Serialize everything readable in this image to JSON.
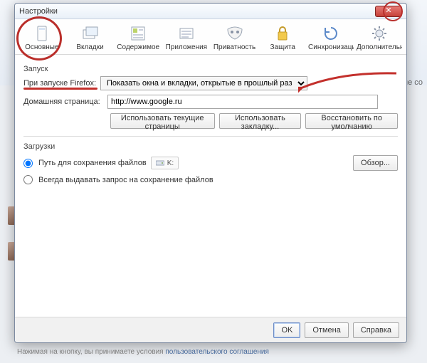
{
  "bg": {
    "right_text_fragment": "ругие со",
    "footer_prefix": "Нажимая на кнопку, вы принимаете условия ",
    "footer_link": "пользовательского соглашения"
  },
  "dialog": {
    "title": "Настройки",
    "close_glyph": "✕",
    "toolbar": [
      {
        "key": "general",
        "label": "Основные"
      },
      {
        "key": "tabs",
        "label": "Вкладки"
      },
      {
        "key": "content",
        "label": "Содержимое"
      },
      {
        "key": "apps",
        "label": "Приложения"
      },
      {
        "key": "privacy",
        "label": "Приватность"
      },
      {
        "key": "security",
        "label": "Защита"
      },
      {
        "key": "sync",
        "label": "Синхронизация"
      },
      {
        "key": "advanced",
        "label": "Дополнительные"
      }
    ],
    "startup": {
      "group_label": "Запуск",
      "prefix_label": "При запуске Firefox:",
      "selected_option": "Показать окна и вкладки, открытые в прошлый раз"
    },
    "homepage": {
      "label": "Домашняя страница:",
      "value": "http://www.google.ru",
      "btn_current": "Использовать текущие страницы",
      "btn_bookmark": "Использовать закладку...",
      "btn_restore": "Восстановить по умолчанию"
    },
    "downloads": {
      "group_label": "Загрузки",
      "radio_save_label": "Путь для сохранения файлов",
      "folder_value": "K:",
      "browse_btn": "Обзор...",
      "radio_ask_label": "Всегда выдавать запрос на сохранение файлов"
    },
    "footer": {
      "ok": "OK",
      "cancel": "Отмена",
      "help": "Справка"
    }
  }
}
